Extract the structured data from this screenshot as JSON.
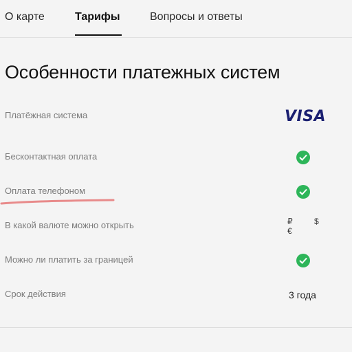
{
  "tabs": [
    {
      "label": "О карте"
    },
    {
      "label": "Тарифы"
    },
    {
      "label": "Вопросы и ответы"
    }
  ],
  "active_tab": "Тарифы",
  "heading": "Особенности платежных систем",
  "rows": [
    {
      "label": "Платёжная система",
      "value": "VISA",
      "value_type": "logo"
    },
    {
      "label": "Бесконтактная оплата",
      "value_type": "check"
    },
    {
      "label": "Оплата телефоном",
      "value_type": "check"
    },
    {
      "label": "В какой валюте можно открыть",
      "value": "₽ $ €",
      "value_type": "text"
    },
    {
      "label": "Можно ли платить за границей",
      "value_type": "check"
    },
    {
      "label": "Срок действия",
      "value": "3 года",
      "value_type": "text"
    }
  ],
  "colors": {
    "check_green": "#2db559",
    "visa_blue": "#1a1f71",
    "highlight_stroke": "#e88a8a"
  },
  "icons": [
    "check-icon",
    "visa-logo"
  ]
}
